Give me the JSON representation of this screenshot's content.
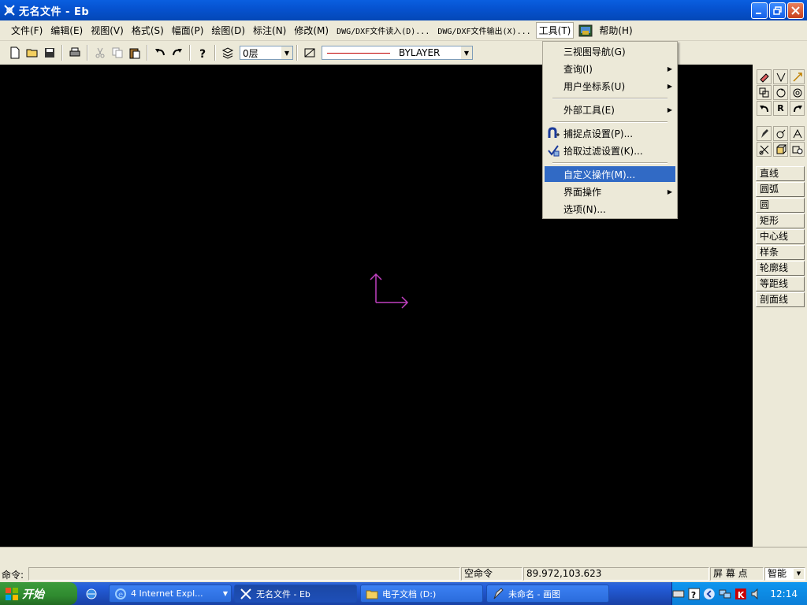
{
  "window": {
    "title": "无名文件 - Eb",
    "minimize_icon": "minimize-icon",
    "maximize_icon": "restore-icon",
    "close_icon": "close-icon"
  },
  "menubar": {
    "items": [
      {
        "label": "文件(F)"
      },
      {
        "label": "编辑(E)"
      },
      {
        "label": "视图(V)"
      },
      {
        "label": "格式(S)"
      },
      {
        "label": "幅面(P)"
      },
      {
        "label": "绘图(D)"
      },
      {
        "label": "标注(N)"
      },
      {
        "label": "修改(M)"
      },
      {
        "label": "DWG/DXF文件读入(D)..."
      },
      {
        "label": "DWG/DXF文件输出(X)..."
      },
      {
        "label": "工具(T)"
      },
      {
        "label": "帮助(H)"
      }
    ]
  },
  "toolbar": {
    "layer": "0层",
    "linetype": "BYLAYER"
  },
  "tools_menu": {
    "items": [
      {
        "label": "三视图导航(G)",
        "submenu": false
      },
      {
        "label": "查询(I)",
        "submenu": true
      },
      {
        "label": "用户坐标系(U)",
        "submenu": true
      },
      {
        "label": "外部工具(E)",
        "submenu": true
      },
      {
        "label": "捕捉点设置(P)...",
        "submenu": false
      },
      {
        "label": "拾取过滤设置(K)...",
        "submenu": false
      },
      {
        "label": "自定义操作(M)...",
        "submenu": false
      },
      {
        "label": "界面操作",
        "submenu": true
      },
      {
        "label": "选项(N)...",
        "submenu": false
      }
    ]
  },
  "right_panel": {
    "draw_buttons": [
      "直线",
      "圆弧",
      "圆",
      "矩形",
      "中心线",
      "样条",
      "轮廓线",
      "等距线",
      "剖面线"
    ]
  },
  "status": {
    "command_label": "命令:",
    "command_state": "空命令",
    "coordinates": "89.972,103.623",
    "snap_mode": "屏 幕 点",
    "snap_option": "智能"
  },
  "taskbar": {
    "start_label": "开始",
    "tasks": [
      {
        "label": "4 Internet Expl..."
      },
      {
        "label": "无名文件 - Eb"
      },
      {
        "label": "电子文档 (D:)"
      },
      {
        "label": "未命名 - 画图"
      }
    ],
    "clock": "12:14"
  },
  "colors": {
    "canvas": "#000000",
    "ucs_axis": "#c040c0",
    "highlight": "#316ac5"
  }
}
